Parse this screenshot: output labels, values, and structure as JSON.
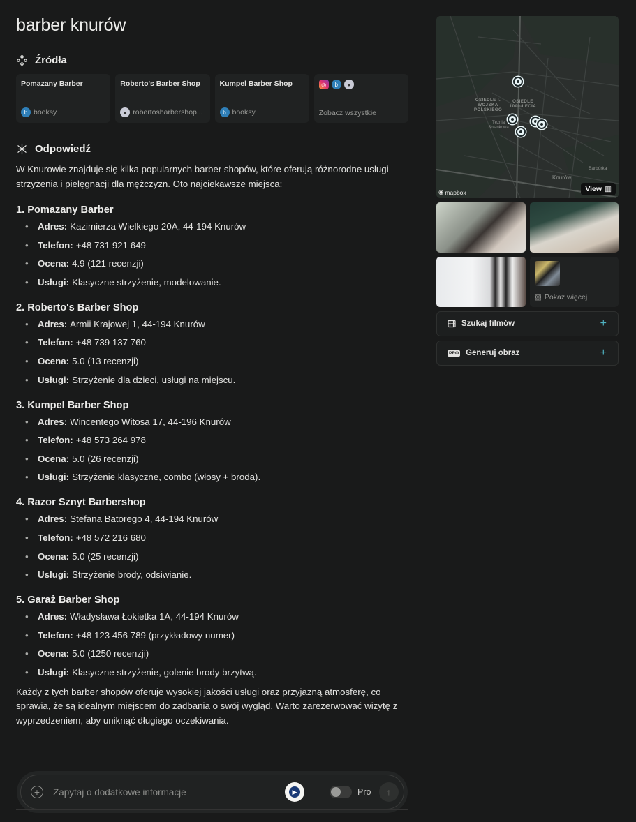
{
  "query": "barber knurów",
  "sources_section": {
    "heading": "Źródła",
    "cards": [
      {
        "title": "Pomazany Barber",
        "site": "booksy",
        "favicon": "booksy-icon"
      },
      {
        "title": "Roberto's Barber Shop",
        "site": "robertosbarbershop...",
        "favicon": "roberto-icon"
      },
      {
        "title": "Kumpel Barber Shop",
        "site": "booksy",
        "favicon": "booksy-icon"
      }
    ],
    "more_label": "Zobacz wszystkie"
  },
  "answer_section": {
    "heading": "Odpowiedź",
    "intro": "W Knurowie znajduje się kilka popularnych barber shopów, które oferują różnorodne usługi strzyżenia i pielęgnacji dla mężczyzn. Oto najciekawsze miejsca:",
    "shops": [
      {
        "title": "1. Pomazany Barber",
        "rows": [
          {
            "label": "Adres:",
            "value": "Kazimierza Wielkiego 20A, 44-194 Knurów"
          },
          {
            "label": "Telefon:",
            "value": "+48 731 921 649"
          },
          {
            "label": "Ocena:",
            "value": "4.9 (121 recenzji)"
          },
          {
            "label": "Usługi:",
            "value": "Klasyczne strzyżenie, modelowanie."
          }
        ]
      },
      {
        "title": "2. Roberto's Barber Shop",
        "rows": [
          {
            "label": "Adres:",
            "value": "Armii Krajowej 1, 44-194 Knurów"
          },
          {
            "label": "Telefon:",
            "value": "+48 739 137 760"
          },
          {
            "label": "Ocena:",
            "value": "5.0 (13 recenzji)"
          },
          {
            "label": "Usługi:",
            "value": "Strzyżenie dla dzieci, usługi na miejscu."
          }
        ]
      },
      {
        "title": "3. Kumpel Barber Shop",
        "rows": [
          {
            "label": "Adres:",
            "value": "Wincentego Witosa 17, 44-196 Knurów"
          },
          {
            "label": "Telefon:",
            "value": "+48 573 264 978"
          },
          {
            "label": "Ocena:",
            "value": "5.0 (26 recenzji)"
          },
          {
            "label": "Usługi:",
            "value": "Strzyżenie klasyczne, combo (włosy + broda)."
          }
        ]
      },
      {
        "title": "4. Razor Sznyt Barbershop",
        "rows": [
          {
            "label": "Adres:",
            "value": "Stefana Batorego 4, 44-194 Knurów"
          },
          {
            "label": "Telefon:",
            "value": "+48 572 216 680"
          },
          {
            "label": "Ocena:",
            "value": "5.0 (25 recenzji)"
          },
          {
            "label": "Usługi:",
            "value": "Strzyżenie brody, odsiwianie."
          }
        ]
      },
      {
        "title": "5. Garaż Barber Shop",
        "rows": [
          {
            "label": "Adres:",
            "value": "Władysława Łokietka 1A, 44-194 Knurów"
          },
          {
            "label": "Telefon:",
            "value": "+48 123 456 789 (przykładowy numer)"
          },
          {
            "label": "Ocena:",
            "value": "5.0 (1250 recenzji)"
          },
          {
            "label": "Usługi:",
            "value": "Klasyczne strzyżenie, golenie brody brzytwą."
          }
        ]
      }
    ],
    "outro": "Każdy z tych barber shopów oferuje wysokiej jakości usługi oraz przyjazną atmosferę, co sprawia, że są idealnym miejscem do zadbania o swój wygląd. Warto zarezerwować wizytę z wyprzedzeniem, aby uniknąć długiego oczekiwania."
  },
  "input": {
    "placeholder": "Zapytaj o dodatkowe informacje",
    "pro_label": "Pro"
  },
  "sidebar": {
    "map": {
      "attribution": "mapbox",
      "view_label": "View",
      "labels": {
        "osiedle_1": "OSIEDLE I. WOJSKA POLSKIEGO",
        "osiedle_2": "OSIEDLE 1000-LECIA",
        "tezniaa": "Tężnia Solankowa",
        "knurow": "Knurów",
        "barborka": "Barbórka"
      }
    },
    "show_more_label": "Pokaż więcej",
    "actions": [
      {
        "label": "Szukaj filmów",
        "icon": "film-icon"
      },
      {
        "label": "Generuj obraz",
        "icon": "pro-badge",
        "badge": "PRO"
      }
    ]
  },
  "colors": {
    "background": "#191a1a",
    "card": "#202222",
    "accent": "#4fb3c2"
  }
}
